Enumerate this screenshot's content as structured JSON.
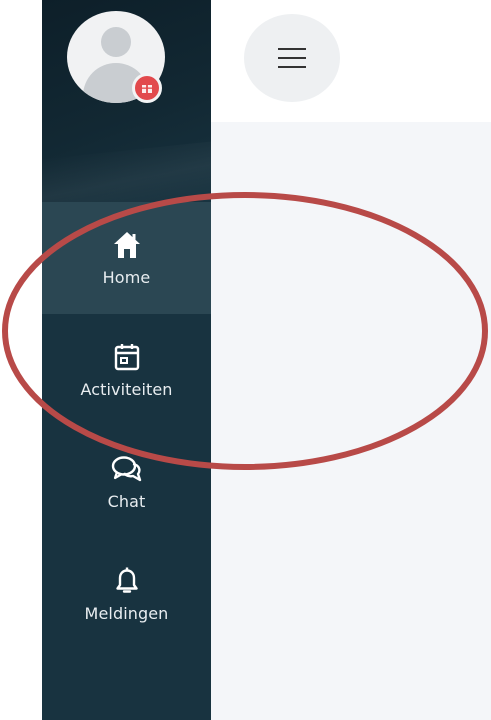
{
  "nav": {
    "items": [
      {
        "label": "Home",
        "icon": "home-icon",
        "active": true
      },
      {
        "label": "Activiteiten",
        "icon": "calendar-icon",
        "active": false
      },
      {
        "label": "Chat",
        "icon": "chat-icon",
        "active": false
      },
      {
        "label": "Meldingen",
        "icon": "bell-icon",
        "active": false
      }
    ]
  },
  "topbar": {
    "menu_icon": "hamburger-menu-icon"
  },
  "avatar": {
    "icon": "user-avatar-icon",
    "badge_icon": "gift-badge-icon",
    "badge_color": "#e24a4d"
  },
  "colors": {
    "sidebar": "#183340",
    "sidebar_active": "#2b4753",
    "content_background": "#f4f6f9",
    "annotation": "#b84a48"
  }
}
